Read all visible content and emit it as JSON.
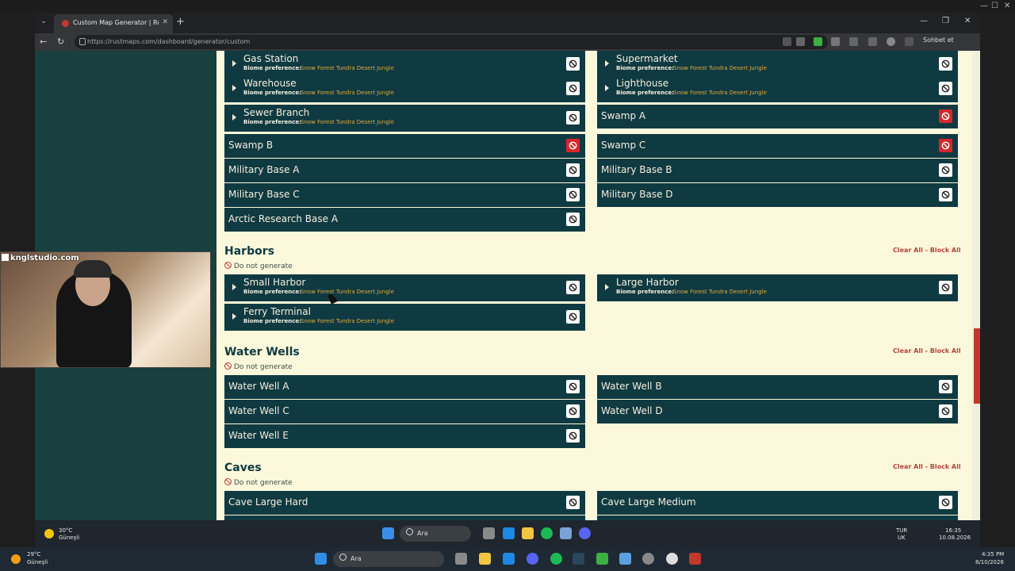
{
  "browser": {
    "tab_title": "Custom Map Generator | RustMaps",
    "url": "https://rustmaps.com/dashboard/generator/custom",
    "chat_label": "Sohbet et"
  },
  "monuments_top": [
    {
      "name": "Gas Station",
      "biome": "Snow Forest Tundra Desert Jungle"
    },
    {
      "name": "Supermarket",
      "biome": "Snow Forest Tundra Desert Jungle"
    },
    {
      "name": "Warehouse",
      "biome": "Snow Forest Tundra Desert Jungle"
    },
    {
      "name": "Lighthouse",
      "biome": "Snow Forest Tundra Desert Jungle"
    },
    {
      "name": "Sewer Branch",
      "biome": "Snow Forest Tundra Desert Jungle"
    }
  ],
  "monuments_plain": [
    {
      "name": "Swamp A",
      "blocked": true
    },
    {
      "name": "Swamp B",
      "blocked": true
    },
    {
      "name": "Swamp C",
      "blocked": true
    },
    {
      "name": "Military Base A",
      "blocked": false
    },
    {
      "name": "Military Base B",
      "blocked": false
    },
    {
      "name": "Military Base C",
      "blocked": false
    },
    {
      "name": "Military Base D",
      "blocked": false
    },
    {
      "name": "Arctic Research Base A",
      "blocked": false
    }
  ],
  "biome_label": "Biome preference:",
  "harbors": {
    "title": "Harbors",
    "do_not_generate": "Do not generate",
    "clear_all": "Clear All - Block All",
    "items": [
      {
        "name": "Small Harbor",
        "biome": "Snow Forest Tundra Desert Jungle"
      },
      {
        "name": "Large Harbor",
        "biome": "Snow Forest Tundra Desert Jungle"
      },
      {
        "name": "Ferry Terminal",
        "biome": "Snow Forest Tundra Desert Jungle"
      }
    ]
  },
  "water_wells": {
    "title": "Water Wells",
    "do_not_generate": "Do not generate",
    "clear_all": "Clear All - Block All",
    "items": [
      "Water Well A",
      "Water Well B",
      "Water Well C",
      "Water Well D",
      "Water Well E"
    ]
  },
  "caves": {
    "title": "Caves",
    "do_not_generate": "Do not generate",
    "clear_all": "Clear All - Block All",
    "items": [
      "Cave Large Hard",
      "Cave Large Medium"
    ]
  },
  "webcam_label": "knglstudio.com",
  "taskbar_inner": {
    "temp": "30°C",
    "weather": "Güneşli",
    "search": "Ara",
    "lang1": "TUR",
    "lang2": "UK",
    "time": "16:35",
    "date": "10.08.2026"
  },
  "taskbar_outer": {
    "temp": "29°C",
    "weather": "Güneşli",
    "search": "Ara",
    "time": "4:35 PM",
    "date": "8/10/2026"
  },
  "colors": {
    "card_bg": "#103a41",
    "page_bg": "#fcf8dc",
    "biome_text": "#e2a93a",
    "blocked": "#d7262b",
    "link": "#b5443b"
  }
}
